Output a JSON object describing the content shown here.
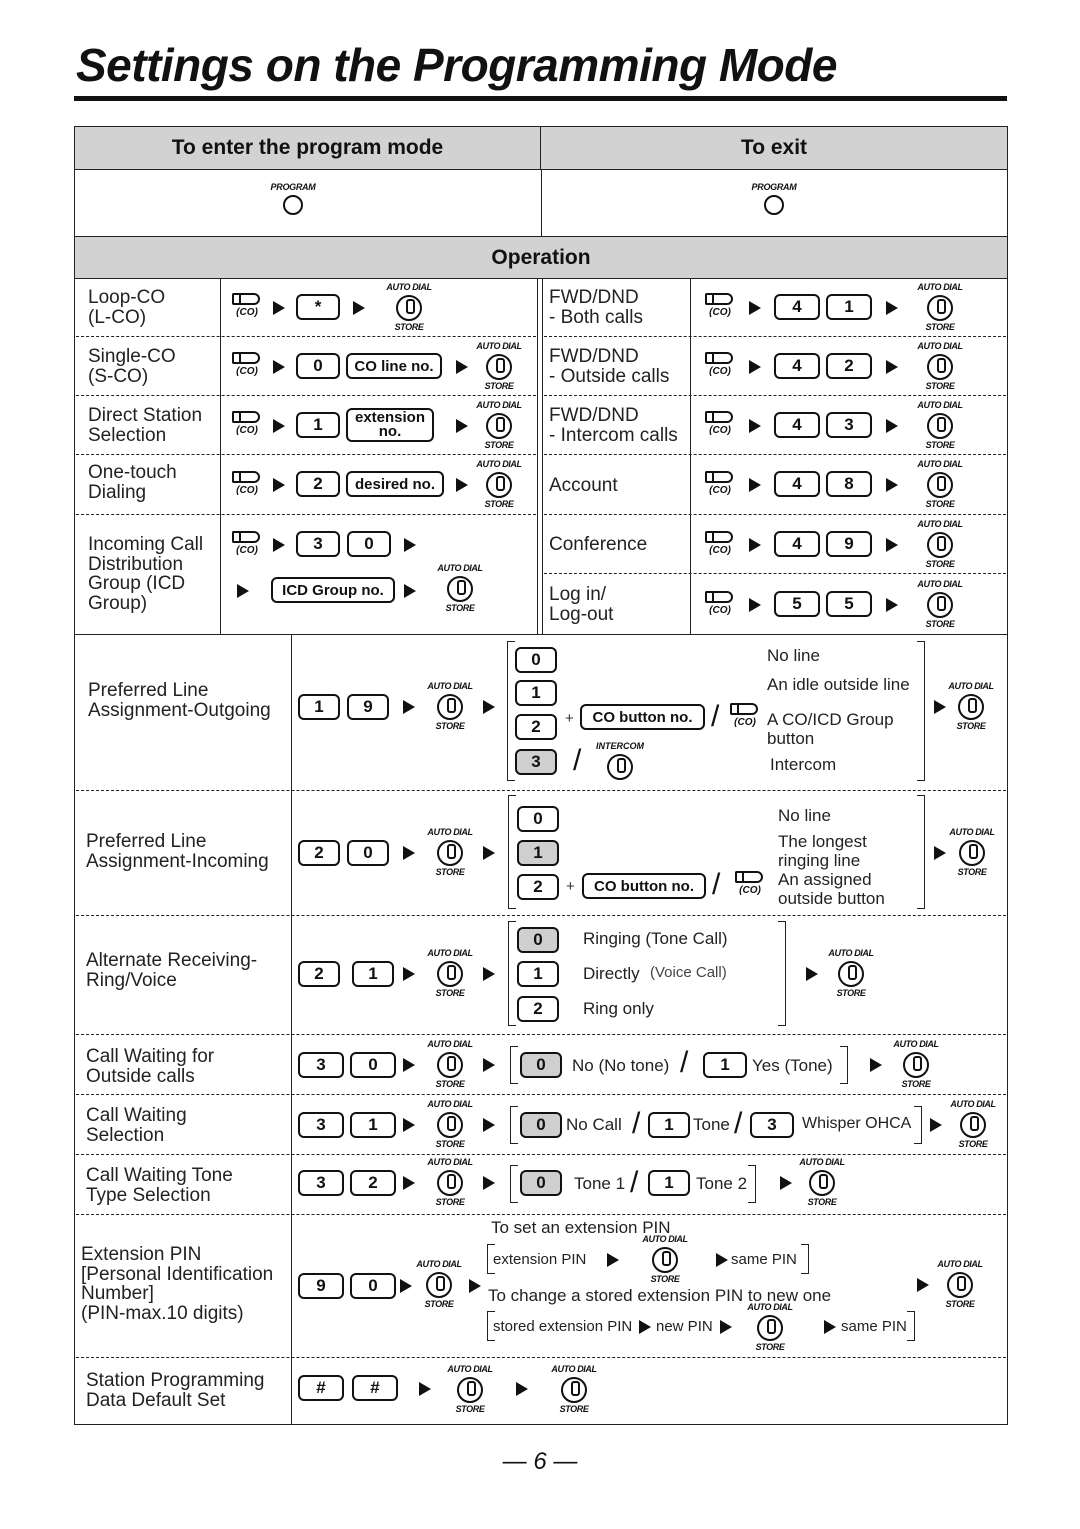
{
  "title": "Settings on the Programming Mode",
  "header": {
    "enter_label": "To enter the program mode",
    "exit_label": "To exit",
    "program_button_label": "PROGRAM",
    "operation_label": "Operation"
  },
  "icons": {
    "auto_dial_top": "AUTO DIAL",
    "auto_dial_bottom": "STORE",
    "co_label": "(CO)",
    "intercom_label": "INTERCOM",
    "arrow": "arrow-right-icon"
  },
  "left_ops": [
    {
      "name": [
        "Loop-CO",
        "(L-CO)"
      ],
      "keys": [
        "*"
      ]
    },
    {
      "name": [
        "Single-CO",
        "(S-CO)"
      ],
      "keys": [
        "0",
        "CO line no."
      ]
    },
    {
      "name": [
        "Direct Station",
        "Selection"
      ],
      "keys": [
        "1",
        "extension no."
      ]
    },
    {
      "name": [
        "One-touch",
        "Dialing"
      ],
      "keys": [
        "2",
        "desired no."
      ]
    },
    {
      "name": [
        "Incoming Call",
        "Distribution",
        "Group (ICD",
        "Group)"
      ],
      "keys": [
        "3",
        "0",
        "ICD Group no."
      ]
    }
  ],
  "right_ops": [
    {
      "name": [
        "FWD/DND",
        "- Both calls"
      ],
      "keys": [
        "4",
        "1"
      ]
    },
    {
      "name": [
        "FWD/DND",
        "- Outside calls"
      ],
      "keys": [
        "4",
        "2"
      ]
    },
    {
      "name": [
        "FWD/DND",
        "- Intercom calls"
      ],
      "keys": [
        "4",
        "3"
      ]
    },
    {
      "name": [
        "Account"
      ],
      "keys": [
        "4",
        "8"
      ]
    },
    {
      "name": [
        "Conference"
      ],
      "keys": [
        "4",
        "9"
      ]
    },
    {
      "name": [
        "Log in/",
        "Log-out"
      ],
      "keys": [
        "5",
        "5"
      ]
    }
  ],
  "wide_ops": {
    "pref_out": {
      "name": [
        "Preferred Line",
        "Assignment-Outgoing"
      ],
      "keys": [
        "1",
        "9"
      ],
      "options": [
        {
          "key": "0",
          "desc": "No line",
          "default": false
        },
        {
          "key": "1",
          "desc": "An idle outside line",
          "default": false
        },
        {
          "key": "2",
          "extra": "CO button no.",
          "desc": "A CO/ICD Group button",
          "default": false
        },
        {
          "key": "3",
          "desc": "Intercom",
          "default": true
        }
      ]
    },
    "pref_in": {
      "name": [
        "Preferred Line",
        "Assignment-Incoming"
      ],
      "keys": [
        "2",
        "0"
      ],
      "options": [
        {
          "key": "0",
          "desc": "No line",
          "default": false
        },
        {
          "key": "1",
          "desc": "The longest ringing line",
          "default": true
        },
        {
          "key": "2",
          "extra": "CO button no.",
          "desc": "An assigned outside button",
          "default": false
        }
      ]
    },
    "alt_ring": {
      "name": [
        "Alternate Receiving-",
        "Ring/Voice"
      ],
      "keys": [
        "2",
        "1"
      ],
      "options": [
        {
          "key": "0",
          "desc": "Ringing (Tone Call)",
          "default": true
        },
        {
          "key": "1",
          "desc": "Directly",
          "note": "(Voice Call)",
          "default": false
        },
        {
          "key": "2",
          "desc": "Ring only",
          "default": false
        }
      ]
    },
    "cw_outside": {
      "name": [
        "Call Waiting for",
        "Outside calls"
      ],
      "keys": [
        "3",
        "0"
      ],
      "options": [
        {
          "key": "0",
          "desc": "No (No tone)",
          "default": true
        },
        {
          "key": "1",
          "desc": "Yes (Tone)",
          "default": false
        }
      ]
    },
    "cw_select": {
      "name": [
        "Call Waiting",
        "Selection"
      ],
      "keys": [
        "3",
        "1"
      ],
      "options": [
        {
          "key": "0",
          "desc": "No Call",
          "default": true
        },
        {
          "key": "1",
          "desc": "Tone",
          "default": false
        },
        {
          "key": "3",
          "desc": "Whisper OHCA",
          "default": false
        }
      ]
    },
    "cw_tone": {
      "name": [
        "Call Waiting Tone",
        "Type Selection"
      ],
      "keys": [
        "3",
        "2"
      ],
      "options": [
        {
          "key": "0",
          "desc": "Tone 1",
          "default": true
        },
        {
          "key": "1",
          "desc": "Tone 2",
          "default": false
        }
      ]
    },
    "pin": {
      "name": [
        "Extension PIN",
        "[Personal Identification",
        "Number]",
        "(PIN-max.10 digits)"
      ],
      "keys": [
        "9",
        "0"
      ],
      "set_heading": "To set an extension PIN",
      "set_step1": "extension PIN",
      "set_step2": "same PIN",
      "change_heading": "To change a stored extension PIN to new one",
      "change_step1": "stored extension PIN",
      "change_step2": "new PIN",
      "change_step3": "same PIN"
    },
    "default_set": {
      "name": [
        "Station Programming",
        "Data Default Set"
      ],
      "keys": [
        "#",
        "#"
      ]
    }
  },
  "page_number": "— 6 —"
}
